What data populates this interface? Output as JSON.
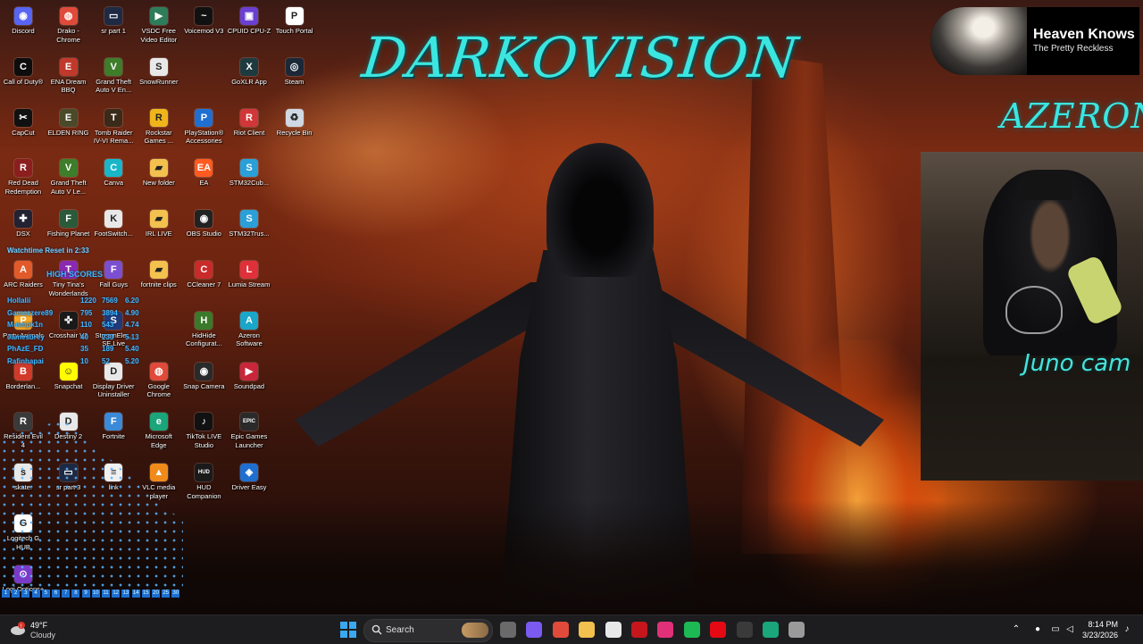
{
  "overlay": {
    "brand_title": "DARKOVISION",
    "sponsor_logo": "AZERON",
    "cam_caption": "Juno cam",
    "now_playing": {
      "title": "Heaven Knows",
      "artist": "The Pretty Reckless"
    },
    "watchtime_text": "Watchtime Reset in 2:33",
    "high_scores_title": "HIGH SCORES",
    "high_scores": [
      [
        "Hollalii",
        "1220",
        "7569",
        "6.20"
      ],
      [
        "Gamezzere89",
        "795",
        "3894",
        "4.90"
      ],
      [
        "M-nmpk1n",
        "110",
        "543",
        "4.74"
      ],
      [
        "Jamesbrey",
        "40",
        "233",
        "5.13"
      ],
      [
        "PhAzE_FD",
        "35",
        "189",
        "5.40"
      ],
      [
        "Rafinhapai",
        "10",
        "52",
        "5.20"
      ]
    ],
    "hud_numbers": [
      "1",
      "2",
      "3",
      "4",
      "5",
      "6",
      "7",
      "8",
      "9",
      "10",
      "11",
      "12",
      "13",
      "14",
      "15",
      "20",
      "25",
      "30"
    ]
  },
  "desktop_icons": [
    {
      "label": "Discord",
      "icon": "discord-icon",
      "color": "#5865f2",
      "glyph": "◉"
    },
    {
      "label": "Drako - Chrome",
      "icon": "chrome-icon",
      "color": "#e04a3a",
      "glyph": "◍"
    },
    {
      "label": "sr part 1",
      "icon": "video-file-icon",
      "color": "#1e2a44",
      "glyph": "▭"
    },
    {
      "label": "VSDC Free Video Editor",
      "icon": "vsdc-icon",
      "color": "#2e7d5a",
      "glyph": "▶"
    },
    {
      "label": "Voicemod V3",
      "icon": "voicemod-icon",
      "color": "#111111",
      "glyph": "~"
    },
    {
      "label": "CPUID CPU-Z",
      "icon": "cpuz-icon",
      "color": "#6a3fd1",
      "glyph": "▣"
    },
    {
      "label": "Touch Portal",
      "icon": "touch-portal-icon",
      "color": "#ffffff",
      "glyph": "P"
    },
    {
      "label": "Call of Duty®",
      "icon": "call-of-duty-icon",
      "color": "#0d0d0d",
      "glyph": "C"
    },
    {
      "label": "ENA Dream BBQ",
      "icon": "ena-dream-bbq-icon",
      "color": "#c0392b",
      "glyph": "E"
    },
    {
      "label": "Grand Theft Auto V En...",
      "icon": "gta-icon",
      "color": "#3e7d2a",
      "glyph": "V"
    },
    {
      "label": "SnowRunner",
      "icon": "snowrunner-icon",
      "color": "#e8e8e8",
      "glyph": "S"
    },
    {
      "label": "GoXLR App",
      "icon": "goxlr-icon",
      "color": "#1d3b3f",
      "glyph": "X"
    },
    {
      "label": "Steam",
      "icon": "steam-icon",
      "color": "#1b2838",
      "glyph": "◎"
    },
    {
      "label": "CapCut",
      "icon": "capcut-icon",
      "color": "#111111",
      "glyph": "✂"
    },
    {
      "label": "ELDEN RING",
      "icon": "elden-ring-icon",
      "color": "#4a4a2a",
      "glyph": "E"
    },
    {
      "label": "Tomb Raider IV-VI Rema...",
      "icon": "tomb-raider-icon",
      "color": "#3a2a1a",
      "glyph": "T"
    },
    {
      "label": "Rockstar Games ...",
      "icon": "rockstar-icon",
      "color": "#f0b51a",
      "glyph": "R"
    },
    {
      "label": "PlayStation® Accessories",
      "icon": "playstation-icon",
      "color": "#1f6fd1",
      "glyph": "P"
    },
    {
      "label": "Riot Client",
      "icon": "riot-icon",
      "color": "#d13639",
      "glyph": "R"
    },
    {
      "label": "Recycle Bin",
      "icon": "recycle-bin-icon",
      "color": "#cfd8e3",
      "glyph": "♻"
    },
    {
      "label": "Red Dead Redemption",
      "icon": "red-dead-icon",
      "color": "#8b1e1e",
      "glyph": "R"
    },
    {
      "label": "Grand Theft Auto V Le...",
      "icon": "gta-icon",
      "color": "#3e7d2a",
      "glyph": "V"
    },
    {
      "label": "Canva",
      "icon": "canva-icon",
      "color": "#19b6c9",
      "glyph": "C"
    },
    {
      "label": "New folder",
      "icon": "folder-icon",
      "color": "#f2c14e",
      "glyph": "▰"
    },
    {
      "label": "EA",
      "icon": "ea-icon",
      "color": "#ff5a1f",
      "glyph": "EA"
    },
    {
      "label": "STM32Cub...",
      "icon": "stm32cube-icon",
      "color": "#2a9fd8",
      "glyph": "S"
    },
    {
      "label": "DSX",
      "icon": "dsx-icon",
      "color": "#222233",
      "glyph": "✚"
    },
    {
      "label": "Fishing Planet",
      "icon": "fishing-planet-icon",
      "color": "#2a5a3a",
      "glyph": "F"
    },
    {
      "label": "FootSwitch...",
      "icon": "footswitch-icon",
      "color": "#e8e8e8",
      "glyph": "K"
    },
    {
      "label": "IRL LIVE",
      "icon": "folder-icon",
      "color": "#f2c14e",
      "glyph": "▰"
    },
    {
      "label": "OBS Studio",
      "icon": "obs-icon",
      "color": "#222222",
      "glyph": "◉"
    },
    {
      "label": "STM32Trus...",
      "icon": "stm32trust-icon",
      "color": "#2a9fd8",
      "glyph": "S"
    },
    {
      "label": "ARC Raiders",
      "icon": "arc-raiders-icon",
      "color": "#e35a2a",
      "glyph": "A"
    },
    {
      "label": "Tiny Tina's Wonderlands",
      "icon": "tiny-tinas-icon",
      "color": "#8a2ab0",
      "glyph": "T"
    },
    {
      "label": "Fall Guys",
      "icon": "fall-guys-icon",
      "color": "#7a4fd0",
      "glyph": "F"
    },
    {
      "label": "fortnite clips",
      "icon": "folder-icon",
      "color": "#f2c14e",
      "glyph": "▰"
    },
    {
      "label": "CCleaner 7",
      "icon": "ccleaner-icon",
      "color": "#c92a2a",
      "glyph": "C"
    },
    {
      "label": "Lumia Stream",
      "icon": "lumia-stream-icon",
      "color": "#e0303a",
      "glyph": "L"
    },
    {
      "label": "Party Animals",
      "icon": "party-animals-icon",
      "color": "#f5a623",
      "glyph": "P"
    },
    {
      "label": "Crosshair V2",
      "icon": "crosshair-icon",
      "color": "#1a1a1a",
      "glyph": "✜"
    },
    {
      "label": "StreamEle... SE.Live",
      "icon": "streamelements-icon",
      "color": "#1e3a7a",
      "glyph": "S"
    },
    {
      "label": "HidHide Configurat...",
      "icon": "hidhide-icon",
      "color": "#3a7a2a",
      "glyph": "H"
    },
    {
      "label": "Azeron Software",
      "icon": "azeron-icon",
      "color": "#1aa6c9",
      "glyph": "A"
    },
    {
      "label": "Borderlan...",
      "icon": "borderlands-icon",
      "color": "#d13a2a",
      "glyph": "B"
    },
    {
      "label": "Snapchat",
      "icon": "snapchat-icon",
      "color": "#fffc00",
      "glyph": "☺"
    },
    {
      "label": "Display Driver Uninstaller",
      "icon": "ddu-icon",
      "color": "#e8e8e8",
      "glyph": "D"
    },
    {
      "label": "Google Chrome",
      "icon": "chrome-icon",
      "color": "#e04a3a",
      "glyph": "◍"
    },
    {
      "label": "Snap Camera",
      "icon": "snap-camera-icon",
      "color": "#2a2a2a",
      "glyph": "◉"
    },
    {
      "label": "Soundpad",
      "icon": "soundpad-icon",
      "color": "#c9263a",
      "glyph": "▶"
    },
    {
      "label": "Resident Evil 4",
      "icon": "resident-evil-icon",
      "color": "#3a3a3a",
      "glyph": "R"
    },
    {
      "label": "Destiny 2",
      "icon": "destiny-icon",
      "color": "#e8e8e8",
      "glyph": "D"
    },
    {
      "label": "Fortnite",
      "icon": "fortnite-icon",
      "color": "#3a8ad8",
      "glyph": "F"
    },
    {
      "label": "Microsoft Edge",
      "icon": "edge-icon",
      "color": "#1aa57a",
      "glyph": "e"
    },
    {
      "label": "TikTok LIVE Studio",
      "icon": "tiktok-icon",
      "color": "#111111",
      "glyph": "♪"
    },
    {
      "label": "Epic Games Launcher",
      "icon": "epic-games-icon",
      "color": "#2a2a2a",
      "glyph": "EPIC"
    },
    {
      "label": "skate.",
      "icon": "skate-icon",
      "color": "#e8e8e8",
      "glyph": "s"
    },
    {
      "label": "sr part 3",
      "icon": "video-file-icon",
      "color": "#1e2a44",
      "glyph": "▭"
    },
    {
      "label": "link",
      "icon": "text-file-icon",
      "color": "#f0f0f0",
      "glyph": "≡"
    },
    {
      "label": "VLC media player",
      "icon": "vlc-icon",
      "color": "#f08a1a",
      "glyph": "▲"
    },
    {
      "label": "HUD Companion",
      "icon": "hud-companion-icon",
      "color": "#1a1a1a",
      "glyph": "HUD"
    },
    {
      "label": "Driver Easy",
      "icon": "driver-easy-icon",
      "color": "#1f6fd1",
      "glyph": "◈"
    },
    {
      "label": "Logitech G HUB",
      "icon": "logitech-ghub-icon",
      "color": "#ffffff",
      "glyph": "G"
    },
    {
      "label": "Logi Options+",
      "icon": "logi-options-icon",
      "color": "#7a3ac9",
      "glyph": "⊙"
    }
  ],
  "taskbar": {
    "weather_temp": "49°F",
    "weather_cond": "Cloudy",
    "search_placeholder": "Search",
    "pinned_apps": [
      {
        "name": "file-explorer",
        "color": "#6a6a6a"
      },
      {
        "name": "copilot",
        "color": "#7a5af0"
      },
      {
        "name": "chrome",
        "color": "#e04a3a"
      },
      {
        "name": "folder",
        "color": "#f2c14e"
      },
      {
        "name": "store",
        "color": "#e8e8e8"
      },
      {
        "name": "red-app",
        "color": "#c4161c"
      },
      {
        "name": "location-app",
        "color": "#e0307a"
      },
      {
        "name": "spotify",
        "color": "#1db954"
      },
      {
        "name": "netflix",
        "color": "#e50914"
      },
      {
        "name": "xbox",
        "color": "#3a3a3a"
      },
      {
        "name": "edge",
        "color": "#1aa57a"
      },
      {
        "name": "obs-recording",
        "color": "#9a9a9a"
      }
    ],
    "time": "8:14 PM",
    "date": "3/23/2026"
  },
  "colors": {
    "accent_cyan": "#3ce6e0",
    "overlay_blue": "#3fb8ff",
    "taskbar": "#1d1d1f"
  }
}
